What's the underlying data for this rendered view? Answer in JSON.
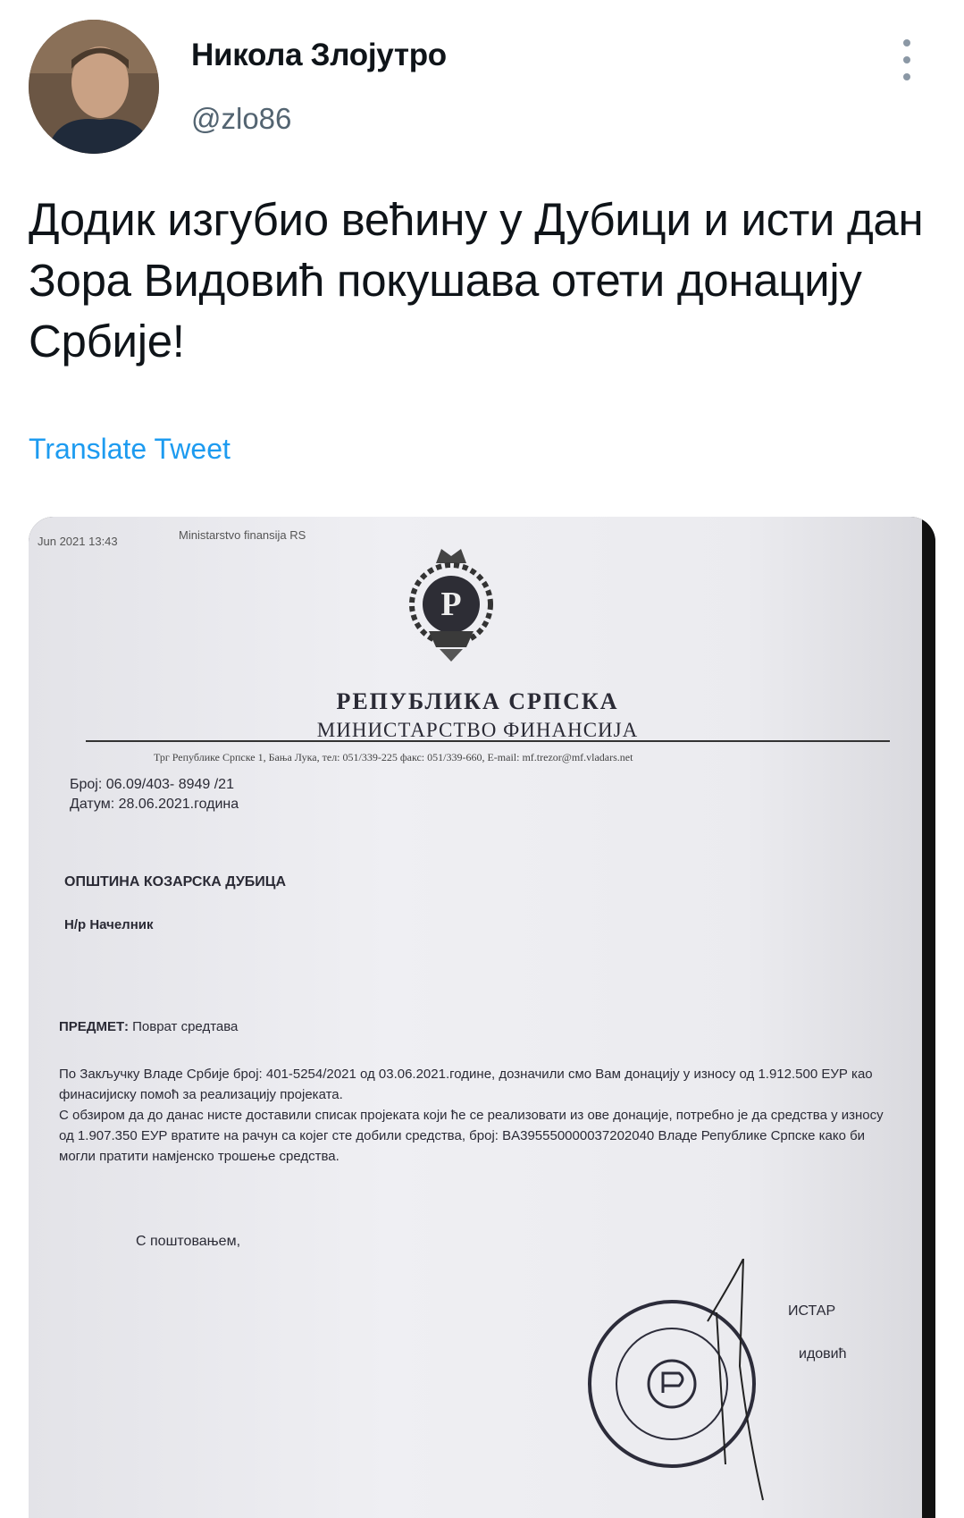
{
  "tweet": {
    "author_name": "Никола Злојутро",
    "handle": "@zlo86",
    "text": "Додик изгубио већину у Дубици и исти дан Зора Видовић покушава отети донацију Србије!",
    "translate_label": "Translate Tweet"
  },
  "icons": {
    "more": "more-vertical-icon"
  },
  "document": {
    "fax_header_date": "Jun 2021 13:43",
    "fax_header_sender": "Ministarstvo finansija RS",
    "republic": "РЕПУБЛИКА СРПСКА",
    "ministry": "МИНИСТАРСТВО ФИНАНСИЈА",
    "address_line": "Трг Републике Српске 1, Бања Лука, тел: 051/339-225 факс: 051/339-660, E-mail: mf.trezor@mf.vladars.net",
    "broj": "Број: 06.09/403- 8949 /21",
    "datum": "Датум: 28.06.2021.година",
    "recipient": "ОПШТИНА КОЗАРСКА ДУБИЦА",
    "attention": "Н/р Начелник",
    "subject_label": "ПРЕДМЕТ:",
    "subject_text": "Поврат средтава",
    "body_line1": "По Закључку Владе Србије број: 401-5254/2021 од 03.06.2021.године, дозначили смо Вам донацију у износу од 1.912.500 ЕУР као финасијиску помоћ за реализацију пројеката.",
    "body_line2": "С обзиром да до данас нисте доставили списак пројеката који ће се реализовати из ове донације, потребно је да средства у износу од 1.907.350 ЕУР вратите на рачун са којег сте добили средства, број: BA395550000037202040 Владе Републике Српске како би могли пратити намјенско трошење средства.",
    "closing": "С поштовањем,",
    "signature_title": "ИСТАР",
    "signature_name": "идовић"
  }
}
